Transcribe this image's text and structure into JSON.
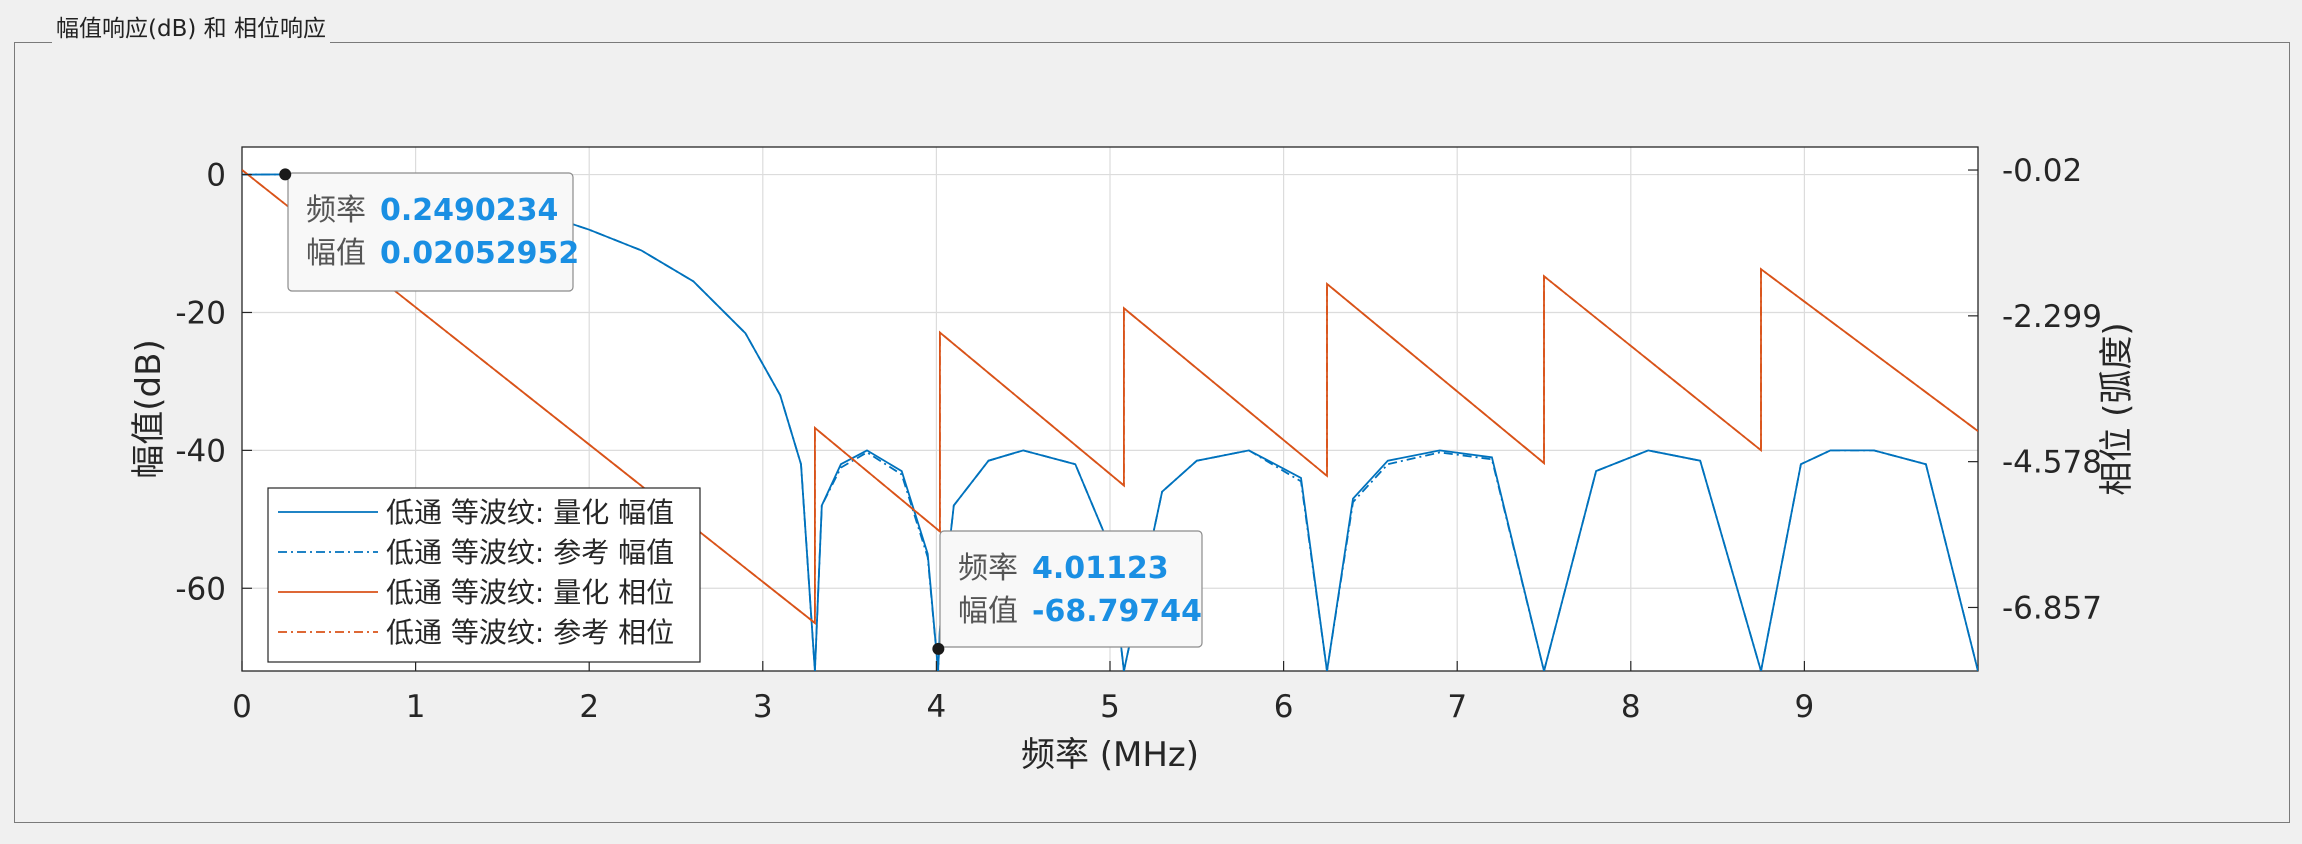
{
  "panel": {
    "title": "幅值响应(dB) 和 相位响应"
  },
  "chart_data": {
    "type": "line",
    "xlabel": "频率 (MHz)",
    "ylabel": "幅值(dB)",
    "y2label": "相位 (弧度)",
    "xlim": [
      0,
      10
    ],
    "ylim": [
      -72,
      4
    ],
    "y2lim": [
      -7.85,
      0.34
    ],
    "xticks": [
      0,
      1,
      2,
      3,
      4,
      5,
      6,
      7,
      8,
      9
    ],
    "yticks": [
      0,
      -20,
      -40,
      -60
    ],
    "ytick_labels": [
      "0",
      "-20",
      "-40",
      "-60"
    ],
    "y2ticks": [
      -0.02,
      -2.299,
      -4.578,
      -6.857
    ],
    "y2tick_labels": [
      "-0.02",
      "-2.299",
      "-4.578",
      "-6.857"
    ],
    "grid": true,
    "legend_position": "lower-left",
    "colors": {
      "magnitude": "#0072BD",
      "phase": "#D95319",
      "datatip_value": "#1a8fe3"
    },
    "series": [
      {
        "name": "低通 等波纹: 量化 幅值",
        "axis": "left",
        "style": "solid",
        "color": "#0072BD",
        "x": [
          0,
          0.25,
          0.5,
          1.0,
          1.5,
          2.0,
          2.3,
          2.6,
          2.9,
          3.1,
          3.22,
          3.3,
          3.34,
          3.45,
          3.6,
          3.8,
          3.95,
          4.01,
          4.02,
          4.1,
          4.3,
          4.5,
          4.8,
          5.0,
          5.08,
          5.3,
          5.5,
          5.8,
          6.1,
          6.25,
          6.4,
          6.6,
          6.9,
          7.2,
          7.5,
          7.8,
          8.1,
          8.4,
          8.75,
          8.98,
          9.15,
          9.4,
          9.7,
          10.0
        ],
        "y": [
          0,
          0.02,
          -0.2,
          -1.6,
          -3.8,
          -8,
          -11,
          -15.5,
          -23,
          -32,
          -42,
          -72,
          -48,
          -42,
          -40,
          -43,
          -55,
          -72,
          -66,
          -48,
          -41.5,
          -40,
          -42,
          -54,
          -72,
          -46,
          -41.5,
          -40,
          -44,
          -72,
          -47,
          -41.5,
          -40,
          -41,
          -72,
          -43,
          -40,
          -41.5,
          -72,
          -42,
          -40,
          -40,
          -42,
          -72
        ]
      },
      {
        "name": "低通 等波纹: 参考 幅值",
        "axis": "left",
        "style": "dashdot",
        "color": "#0072BD",
        "x": [
          0,
          0.25,
          0.5,
          1.0,
          1.5,
          2.0,
          2.3,
          2.6,
          2.9,
          3.1,
          3.22,
          3.3,
          3.34,
          3.45,
          3.6,
          3.8,
          3.95,
          4.01,
          4.02,
          4.1,
          4.3,
          4.5,
          4.8,
          5.0,
          5.08,
          5.3,
          5.5,
          5.8,
          6.1,
          6.25,
          6.4,
          6.6,
          6.9,
          7.2,
          7.5,
          7.8,
          8.1,
          8.4,
          8.75,
          8.98,
          9.15,
          9.4,
          9.7,
          10.0
        ],
        "y": [
          0,
          0.02,
          -0.2,
          -1.6,
          -3.8,
          -8,
          -11,
          -15.5,
          -23,
          -32,
          -42,
          -72,
          -48,
          -42.5,
          -40.3,
          -43.5,
          -55.5,
          -72,
          -66,
          -48,
          -41.5,
          -40,
          -42,
          -54,
          -72,
          -46,
          -41.5,
          -40,
          -44.5,
          -72,
          -47.5,
          -42,
          -40.3,
          -41.3,
          -72,
          -43,
          -40,
          -41.5,
          -72,
          -42,
          -40,
          -40,
          -42,
          -72
        ]
      },
      {
        "name": "低通 等波纹: 量化 相位",
        "axis": "right",
        "style": "solid",
        "color": "#D95319",
        "x": [
          0,
          3.3,
          3.3,
          4.02,
          4.02,
          5.08,
          5.08,
          6.25,
          6.25,
          7.5,
          7.5,
          8.75,
          8.75,
          10.0
        ],
        "y": [
          -0.02,
          -7.1,
          -4.05,
          -5.67,
          -2.56,
          -4.95,
          -2.18,
          -4.8,
          -1.8,
          -4.6,
          -1.68,
          -4.4,
          -1.57,
          -4.1
        ]
      },
      {
        "name": "低通 等波纹: 参考 相位",
        "axis": "right",
        "style": "dashdot",
        "color": "#D95319",
        "x": [
          0,
          3.3,
          3.3,
          4.02,
          4.02,
          5.08,
          5.08,
          6.25,
          6.25,
          7.5,
          7.5,
          8.75,
          8.75,
          10.0
        ],
        "y": [
          -0.02,
          -7.1,
          -4.05,
          -5.67,
          -2.56,
          -4.95,
          -2.18,
          -4.8,
          -1.8,
          -4.6,
          -1.68,
          -4.4,
          -1.57,
          -4.1
        ]
      }
    ],
    "datatips": [
      {
        "x": 0.2490234,
        "y": 0.02052952,
        "label_x": "频率",
        "value_x": "0.2490234",
        "label_y": "幅值",
        "value_y": "0.02052952"
      },
      {
        "x": 4.01123,
        "y": -68.79744,
        "label_x": "频率",
        "value_x": "4.01123",
        "label_y": "幅值",
        "value_y": "-68.79744"
      }
    ]
  }
}
